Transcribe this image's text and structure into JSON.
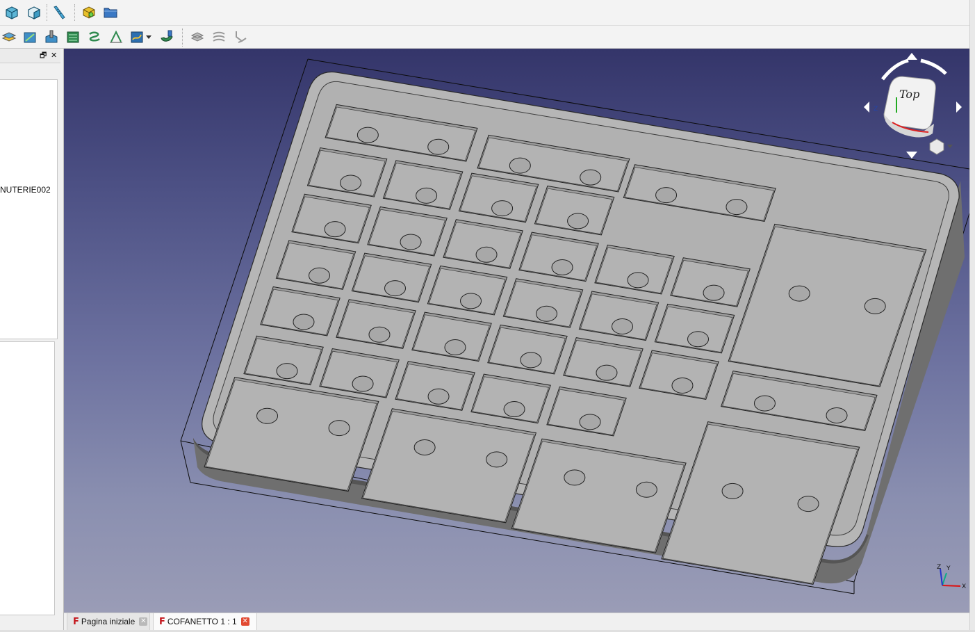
{
  "toolbar_top": {
    "icons": [
      "view-isometric-icon",
      "view-front-icon",
      "measure-icon",
      "part-box-icon",
      "open-folder-icon"
    ]
  },
  "toolbar_path": {
    "icons": [
      "path-job-icon",
      "path-profile-icon",
      "path-pocket-icon",
      "path-face-icon",
      "path-helix-icon",
      "path-engrave-icon",
      "path-surface-icon",
      "path-drill-icon",
      "path-adaptive-icon",
      "path-waterline-icon",
      "path-vcarve-icon"
    ]
  },
  "panel": {
    "tree_item_label": "NUTERIE002",
    "float_symbol": "🗗",
    "close_symbol": "✕"
  },
  "navcube": {
    "face_label": "Top",
    "axis_label": "Z"
  },
  "axis_gizmo": {
    "x": "X",
    "y": "Y",
    "z": "Z"
  },
  "tabs": [
    {
      "label": "Pagina iniziale",
      "active": false
    },
    {
      "label": "COFANETTO 1 : 1",
      "active": true
    }
  ],
  "colors": {
    "model_top": "#b6b6b6",
    "model_side": "#6f6f6f",
    "close_active": "#e24a32",
    "freecad_red": "#c4161c"
  }
}
